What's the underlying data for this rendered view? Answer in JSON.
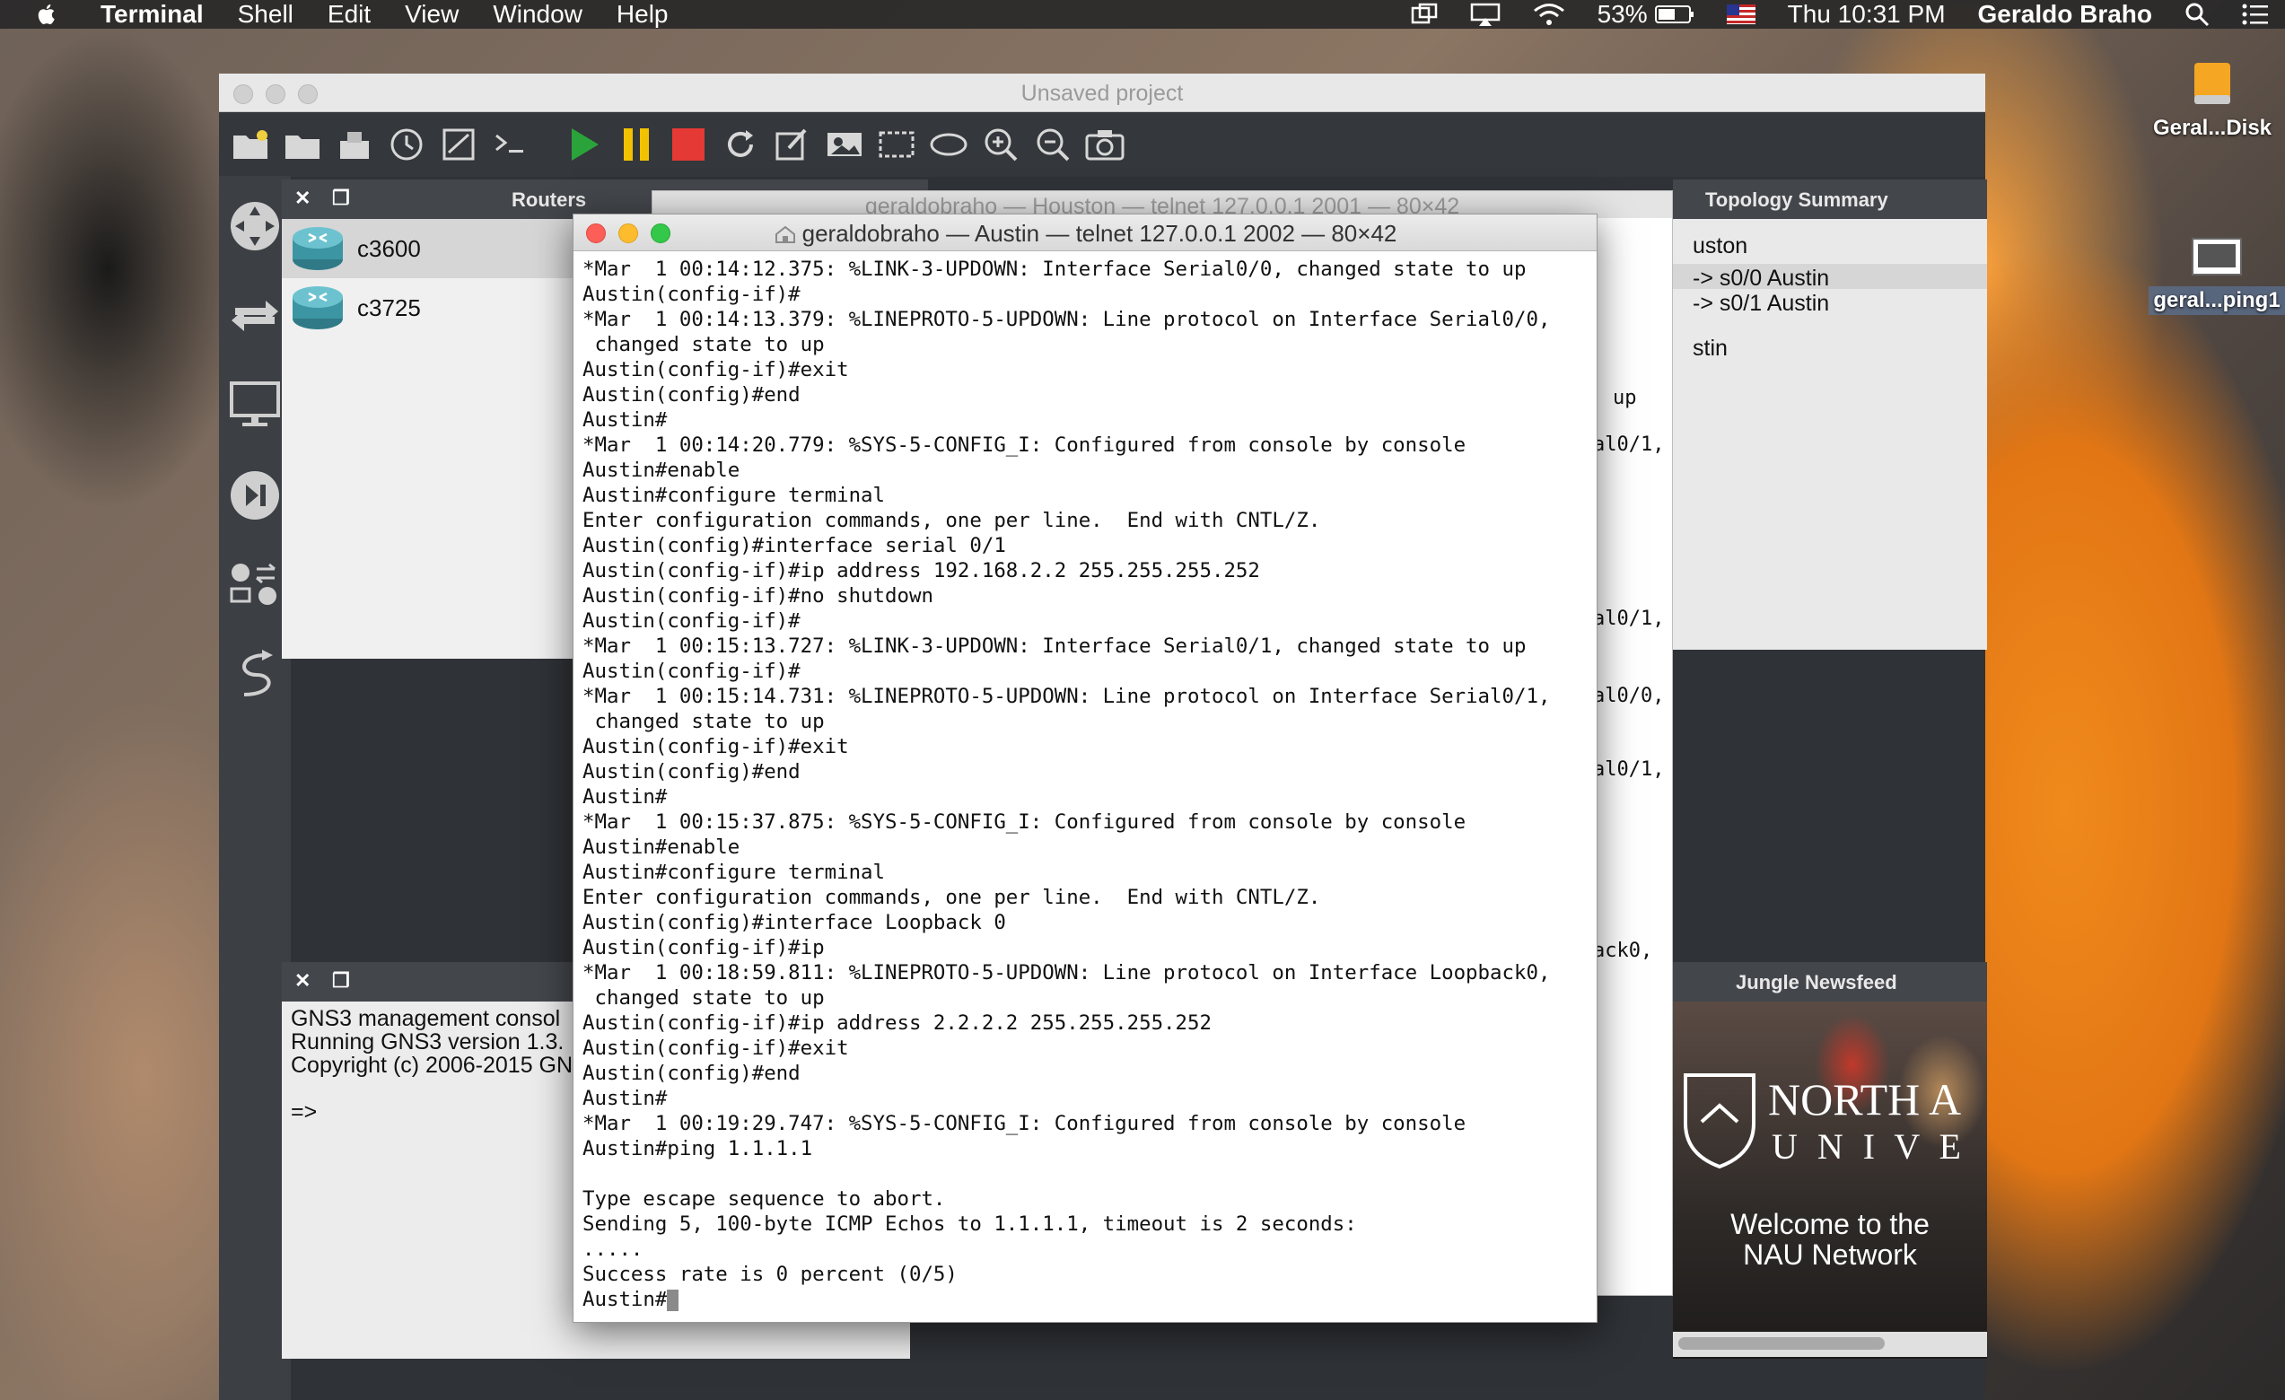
{
  "menubar": {
    "app": "Terminal",
    "items": [
      "Shell",
      "Edit",
      "View",
      "Window",
      "Help"
    ],
    "battery": "53%",
    "clock": "Thu 10:31 PM",
    "user": "Geraldo Braho"
  },
  "desktop": {
    "icons": [
      {
        "label": "Geral...Disk",
        "icon": "disk-icon"
      },
      {
        "label": "geral...ping1",
        "icon": "screenshot-file-icon"
      }
    ]
  },
  "gns3": {
    "window_title": "Unsaved project",
    "routers_panel": {
      "title": "Routers",
      "items": [
        "c3600",
        "c3725"
      ]
    },
    "topology_panel": {
      "title": "Topology Summary",
      "lines": [
        "uston",
        "-> s0/0 Austin",
        "-> s0/1 Austin",
        "stin"
      ]
    },
    "console_panel": {
      "lines": [
        "GNS3 management consol",
        "Running GNS3 version 1.3.",
        "Copyright (c) 2006-2015 GN",
        "",
        "=>"
      ]
    },
    "newsfeed_panel": {
      "title": "Jungle Newsfeed",
      "brand_line1": "NORTH A",
      "brand_line2": "U N I V E",
      "welcome_line1": "Welcome to the",
      "welcome_line2": "NAU Network"
    }
  },
  "houston_terminal": {
    "title": "geraldobraho — Houston — telnet 127.0.0.1 2001 — 80×42",
    "fragments": [
      "up",
      "al0/1,",
      "al0/1,",
      "al0/0,",
      "al0/1,",
      "ack0,"
    ]
  },
  "austin_terminal": {
    "title": "geraldobraho — Austin — telnet 127.0.0.1 2002 — 80×42",
    "lines": [
      "*Mar  1 00:14:12.375: %LINK-3-UPDOWN: Interface Serial0/0, changed state to up",
      "Austin(config-if)#",
      "*Mar  1 00:14:13.379: %LINEPROTO-5-UPDOWN: Line protocol on Interface Serial0/0,",
      " changed state to up",
      "Austin(config-if)#exit",
      "Austin(config)#end",
      "Austin#",
      "*Mar  1 00:14:20.779: %SYS-5-CONFIG_I: Configured from console by console",
      "Austin#enable",
      "Austin#configure terminal",
      "Enter configuration commands, one per line.  End with CNTL/Z.",
      "Austin(config)#interface serial 0/1",
      "Austin(config-if)#ip address 192.168.2.2 255.255.255.252",
      "Austin(config-if)#no shutdown",
      "Austin(config-if)#",
      "*Mar  1 00:15:13.727: %LINK-3-UPDOWN: Interface Serial0/1, changed state to up",
      "Austin(config-if)#",
      "*Mar  1 00:15:14.731: %LINEPROTO-5-UPDOWN: Line protocol on Interface Serial0/1,",
      " changed state to up",
      "Austin(config-if)#exit",
      "Austin(config)#end",
      "Austin#",
      "*Mar  1 00:15:37.875: %SYS-5-CONFIG_I: Configured from console by console",
      "Austin#enable",
      "Austin#configure terminal",
      "Enter configuration commands, one per line.  End with CNTL/Z.",
      "Austin(config)#interface Loopback 0",
      "Austin(config-if)#ip",
      "*Mar  1 00:18:59.811: %LINEPROTO-5-UPDOWN: Line protocol on Interface Loopback0,",
      " changed state to up",
      "Austin(config-if)#ip address 2.2.2.2 255.255.255.252",
      "Austin(config-if)#exit",
      "Austin(config)#end",
      "Austin#",
      "*Mar  1 00:19:29.747: %SYS-5-CONFIG_I: Configured from console by console",
      "Austin#ping 1.1.1.1",
      "",
      "Type escape sequence to abort.",
      "Sending 5, 100-byte ICMP Echos to 1.1.1.1, timeout is 2 seconds:",
      ".....",
      "Success rate is 0 percent (0/5)",
      "Austin#"
    ]
  },
  "colors": {
    "play": "#2aa43a",
    "pause": "#f2c200",
    "stop": "#e53935",
    "close_light": "#fc5f57",
    "min_light": "#fdbc2e",
    "max_light": "#34c84a"
  }
}
